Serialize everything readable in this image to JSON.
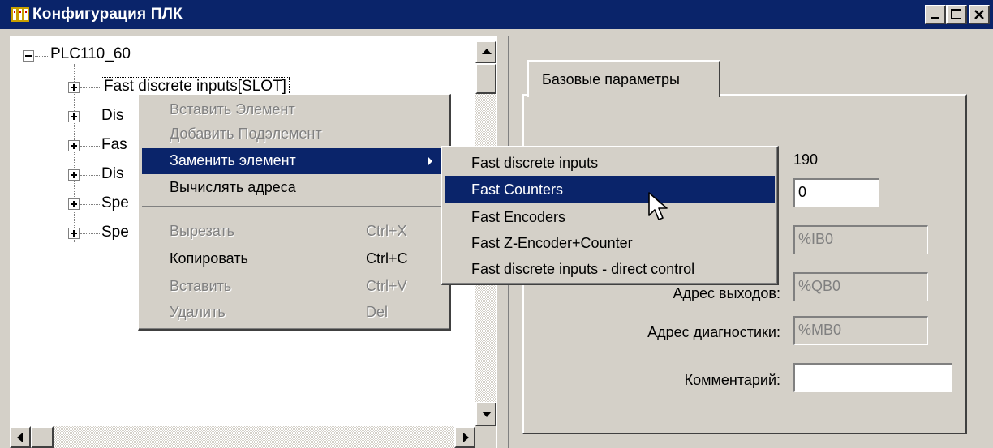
{
  "window": {
    "title": "Конфигурация ПЛК",
    "buttons": [
      "minimize",
      "maximize",
      "close"
    ]
  },
  "tree": {
    "root": "PLC110_60",
    "children": [
      "Fast discrete inputs[SLOT]",
      "Dis",
      "Fas",
      "Dis",
      "Spe",
      "Spe"
    ]
  },
  "context_menu": {
    "items": [
      {
        "label": "Вставить Элемент",
        "shortcut": "",
        "enabled": false
      },
      {
        "label": "Добавить Подэлемент",
        "shortcut": "",
        "enabled": false
      },
      {
        "label": "Заменить элемент",
        "shortcut": "",
        "enabled": true,
        "selected": true,
        "submenu": true
      },
      {
        "label": "Вычислять адреса",
        "shortcut": "",
        "enabled": true
      },
      {
        "label": "Вырезать",
        "shortcut": "Ctrl+X",
        "enabled": false
      },
      {
        "label": "Копировать",
        "shortcut": "Ctrl+C",
        "enabled": true
      },
      {
        "label": "Вставить",
        "shortcut": "Ctrl+V",
        "enabled": false
      },
      {
        "label": "Удалить",
        "shortcut": "Del",
        "enabled": false
      }
    ]
  },
  "submenu": {
    "items": [
      {
        "label": "Fast discrete inputs"
      },
      {
        "label": "Fast Counters",
        "selected": true
      },
      {
        "label": "Fast Encoders"
      },
      {
        "label": "Fast Z-Encoder+Counter"
      },
      {
        "label": "Fast discrete inputs - direct control"
      }
    ]
  },
  "props": {
    "tab_label": "Базовые параметры",
    "value_190": "190",
    "input_value": "0",
    "input_address": "%IB0",
    "output_label_partial": "Адрес выходов:",
    "output_address": "%QB0",
    "diag_label": "Адрес диагностики:",
    "diag_address": "%MB0",
    "comment_label": "Комментарий:",
    "comment_value": ""
  },
  "colors": {
    "titlebar": "#0a246a",
    "face": "#d4d0c8",
    "highlight": "#0a246a",
    "disabled_text": "#808080"
  }
}
